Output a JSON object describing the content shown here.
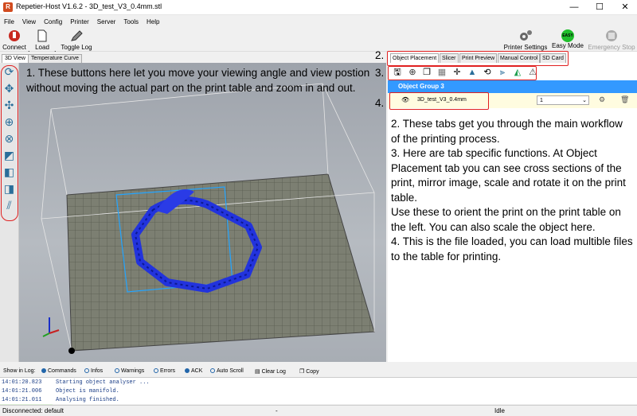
{
  "window": {
    "title": "Repetier-Host V1.6.2 - 3D_test_V3_0.4mm.stl",
    "app_icon": "R",
    "minimize": "—",
    "maximize": "☐",
    "close": "✕"
  },
  "menu": [
    "File",
    "View",
    "Config",
    "Printer",
    "Server",
    "Tools",
    "Help"
  ],
  "toolbar": {
    "connect": "Connect",
    "load": "Load",
    "toggle_log": "Toggle Log",
    "printer_settings": "Printer Settings",
    "easy_mode": "Easy Mode",
    "easy_badge": "EASY",
    "emergency_stop": "Emergency Stop"
  },
  "view_tabs": [
    "3D View",
    "Temperature Curve"
  ],
  "right_tabs": [
    "Object Placement",
    "Slicer",
    "Print Preview",
    "Manual Control",
    "SD Card"
  ],
  "object_panel": {
    "group": "Object Group 3",
    "file": "3D_test_V3_0.4mm",
    "copies": "1"
  },
  "annotations": {
    "left_text": "1. These buttons here let you move your viewing angle and view postion without moving the actual part on the print table and zoom in and out.",
    "num2": "2.",
    "num3": "3.",
    "num4": "4.",
    "right_text": [
      "2. These tabs get you through the main workflow of the printing process.",
      "3. Here are tab specific functions. At Object Placement tab you can see cross sections of the print, mirror image, scale and rotate it on the print table.",
      "Use these to orient the print on the print table on the left. You can also scale the object here.",
      "4. This is the file loaded, you can load multible files to the table for printing."
    ]
  },
  "log_bar": {
    "show_in_log": "Show in Log:",
    "commands": "Commands",
    "infos": "Infos",
    "warnings": "Warnings",
    "errors": "Errors",
    "ack": "ACK",
    "auto_scroll": "Auto Scroll",
    "clear_log": "Clear Log",
    "copy": "Copy"
  },
  "log": [
    {
      "time": "14:01:20.823",
      "msg": "Starting object analyser ..."
    },
    {
      "time": "14:01:21.006",
      "msg": "Object is manifold."
    },
    {
      "time": "14:01:21.011",
      "msg": "Analysing finished."
    }
  ],
  "status": {
    "connection": "Disconnected: default",
    "dash": "-",
    "state": "Idle"
  },
  "colors": {
    "accent": "#3399ff",
    "part": "#2233dd",
    "annotation_red": "#e02020",
    "bed": "#7c7f72"
  }
}
